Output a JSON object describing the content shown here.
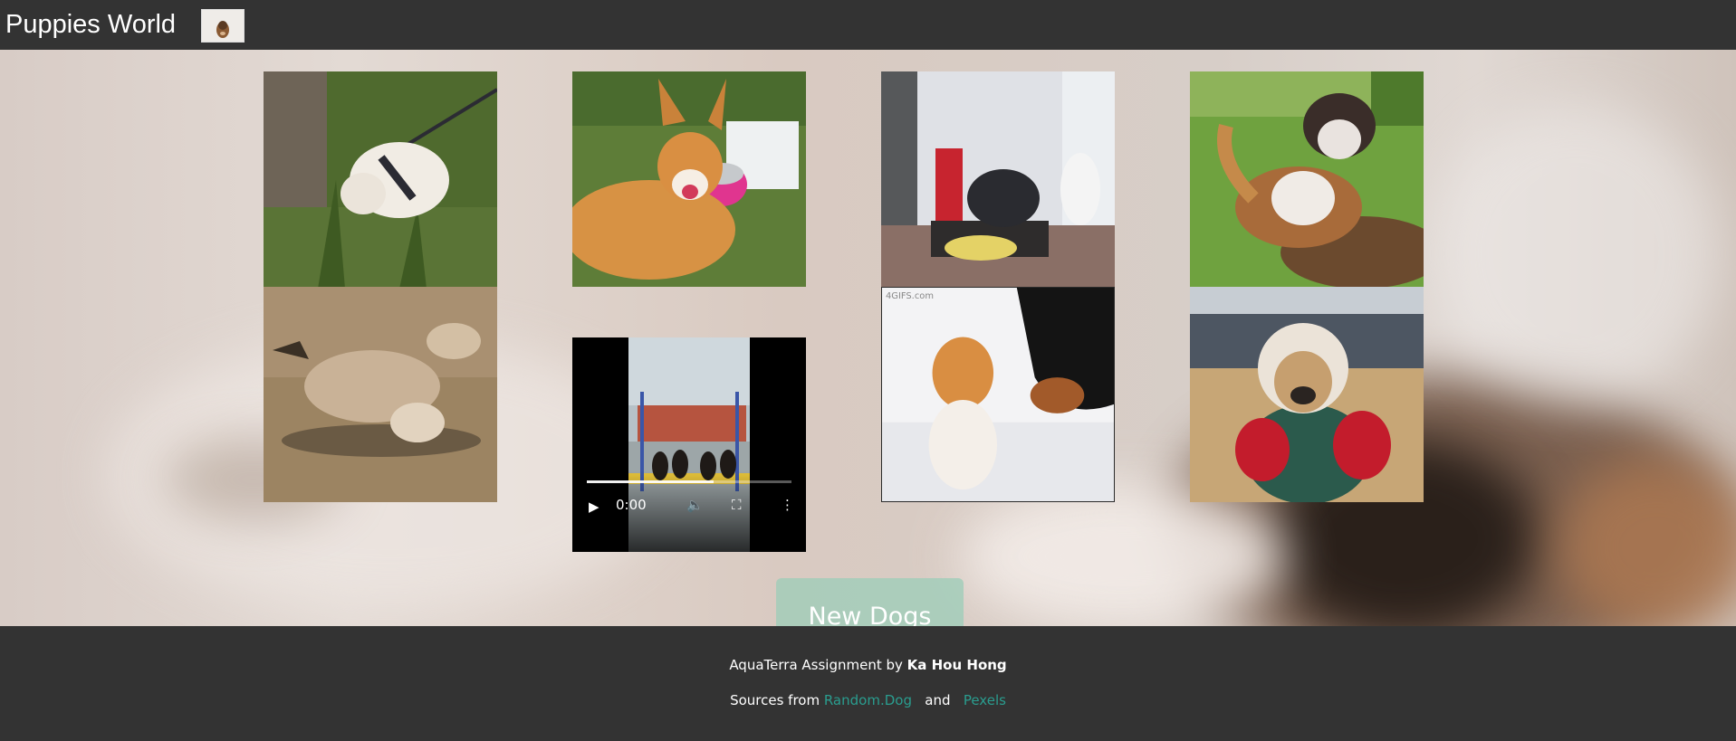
{
  "header": {
    "title": "Puppies World",
    "logo_icon": "dog-logo-icon"
  },
  "gallery": {
    "items": [
      {
        "type": "image",
        "subject": "white fluffy puppy on leash in grass"
      },
      {
        "type": "image",
        "subject": "corgi lying on grass with pink bowl"
      },
      {
        "type": "image",
        "subject": "husky puppies indoors (gif)"
      },
      {
        "type": "image",
        "subject": "husky-mix dog in yard"
      },
      {
        "type": "image",
        "subject": "dog rolling on sand"
      },
      {
        "type": "video",
        "subject": "puppies on swing",
        "time": "0:00",
        "progress": 0.62
      },
      {
        "type": "image",
        "subject": "orange cat and black dog in snow (gif)",
        "watermark": "4GIFS.com"
      },
      {
        "type": "image",
        "subject": "dog in hooded jacket with backpack"
      }
    ]
  },
  "actions": {
    "new_dogs_label": "New Dogs"
  },
  "footer": {
    "line1_prefix": "AquaTerra Assignment by ",
    "author": "Ka Hou Hong",
    "line2_prefix": "Sources from ",
    "source1": "Random.Dog",
    "and": "and",
    "source2": "Pexels"
  },
  "colors": {
    "bar": "#333333",
    "button": "#9ecdb9",
    "link": "#2a9d8f"
  }
}
